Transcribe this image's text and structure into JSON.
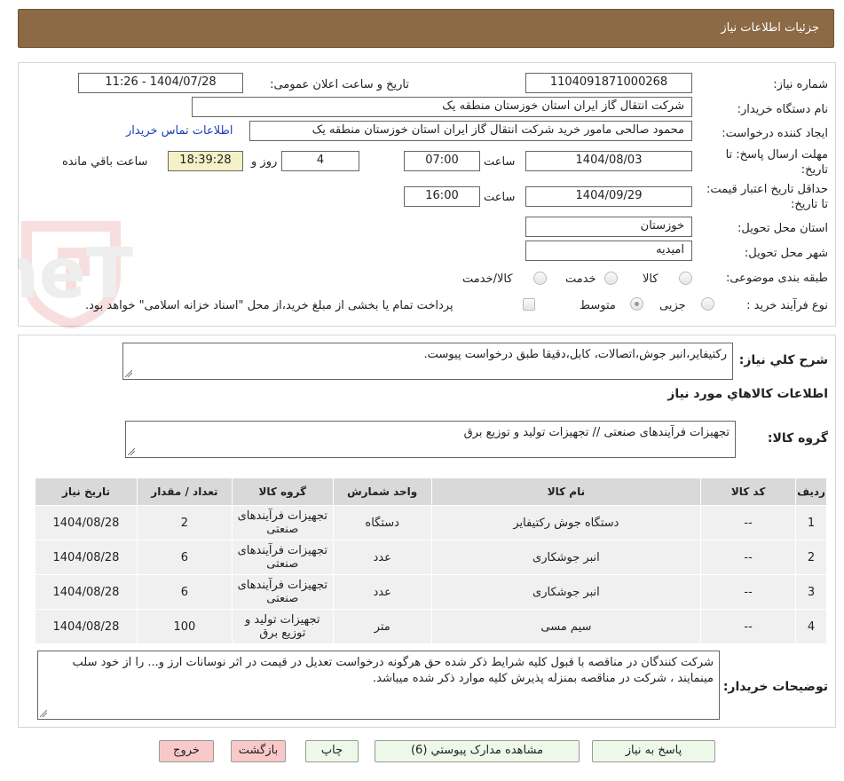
{
  "header": {
    "title": "جزئیات اطلاعات نیاز"
  },
  "form": {
    "need_number_label": "شماره نیاز:",
    "need_number": "1104091871000268",
    "announce_label": "تاریخ و ساعت اعلان عمومی:",
    "announce_value": "1404/07/28 - 11:26",
    "buyer_org_label": "نام دستگاه خریدار:",
    "buyer_org": "شرکت انتقال گاز ایران  استان خوزستان منطقه یک",
    "creator_label": "ایجاد کننده درخواست:",
    "creator": "محمود صالحی مامور خرید شرکت انتقال گاز ایران  استان خوزستان منطقه یک",
    "contact_link": "اطلاعات تماس خریدار",
    "send_deadline_label": "مهلت ارسال پاسخ: تا تاریخ:",
    "send_deadline_date": "1404/08/03",
    "time_label": "ساعت",
    "send_deadline_time": "07:00",
    "days_value": "4",
    "days_label": "روز و",
    "remaining_time": "18:39:28",
    "remaining_label": "ساعت باقي مانده",
    "price_validity_label": "حداقل تاریخ اعتبار قیمت: تا تاریخ:",
    "price_validity_date": "1404/09/29",
    "price_validity_time": "16:00",
    "province_label": "استان محل تحویل:",
    "province": "خوزستان",
    "city_label": "شهر محل تحویل:",
    "city": "امیدیه",
    "category_label": "طبقه بندی موضوعی:",
    "category_options": [
      "کالا",
      "خدمت",
      "کالا/خدمت"
    ],
    "process_label": "نوع فرآیند خرید :",
    "process_options": [
      "جزیی",
      "متوسط"
    ],
    "payment_note": "پرداخت تمام یا بخشی از مبلغ خرید،از محل \"اسناد خزانه اسلامی\" خواهد بود."
  },
  "summary": {
    "label": "شرح کلي نياز:",
    "text": "رکتیفایر،انبر جوش،اتصالات، کابل،دقیقا طبق درخواست پیوست."
  },
  "goods_section": {
    "title": "اطلاعات کالاهاي مورد نياز",
    "group_label": "گروه کالا:",
    "group_value": "تجهیزات فرآیندهای صنعتی // تجهیزات تولید و توزیع برق"
  },
  "table": {
    "headers": [
      "رديف",
      "کد کالا",
      "نام کالا",
      "واحد شمارش",
      "گروه کالا",
      "تعداد / مقدار",
      "تاريخ نياز"
    ],
    "rows": [
      [
        "1",
        "--",
        "دستگاه جوش رکتیفایر",
        "دستگاه",
        "تجهیزات فرآیندهای صنعتی",
        "2",
        "1404/08/28"
      ],
      [
        "2",
        "--",
        "انبر جوشکاری",
        "عدد",
        "تجهیزات فرآیندهای صنعتی",
        "6",
        "1404/08/28"
      ],
      [
        "3",
        "--",
        "انبر جوشکاری",
        "عدد",
        "تجهیزات فرآیندهای صنعتی",
        "6",
        "1404/08/28"
      ],
      [
        "4",
        "--",
        "سیم مسی",
        "متر",
        "تجهیزات تولید و توزیع برق",
        "100",
        "1404/08/28"
      ]
    ]
  },
  "buyer_notes": {
    "label": "توضیحات خریدار:",
    "text": "شرکت کنندگان در مناقصه با قبول کلیه شرایط ذکر شده حق هرگونه درخواست تعدیل در قیمت در اثر نوسانات ارز و... را از خود سلب مینمایند ، شرکت در مناقصه بمنزله پذیرش کلیه موارد ذکر شده میباشد."
  },
  "buttons": {
    "reply": "پاسخ به نياز",
    "attachments": "مشاهده مدارک پيوستي (6)",
    "print": "چاپ",
    "back": "بازگشت",
    "exit": "خروج"
  },
  "watermark": {
    "text": "AriaTender.neT"
  },
  "colors": {
    "header_bg": "#8b6a45",
    "yellow_box": "#f4f1c7",
    "green_button": "#eef8e8",
    "red_button": "#f9c9c9",
    "link": "#1a3fb5"
  }
}
